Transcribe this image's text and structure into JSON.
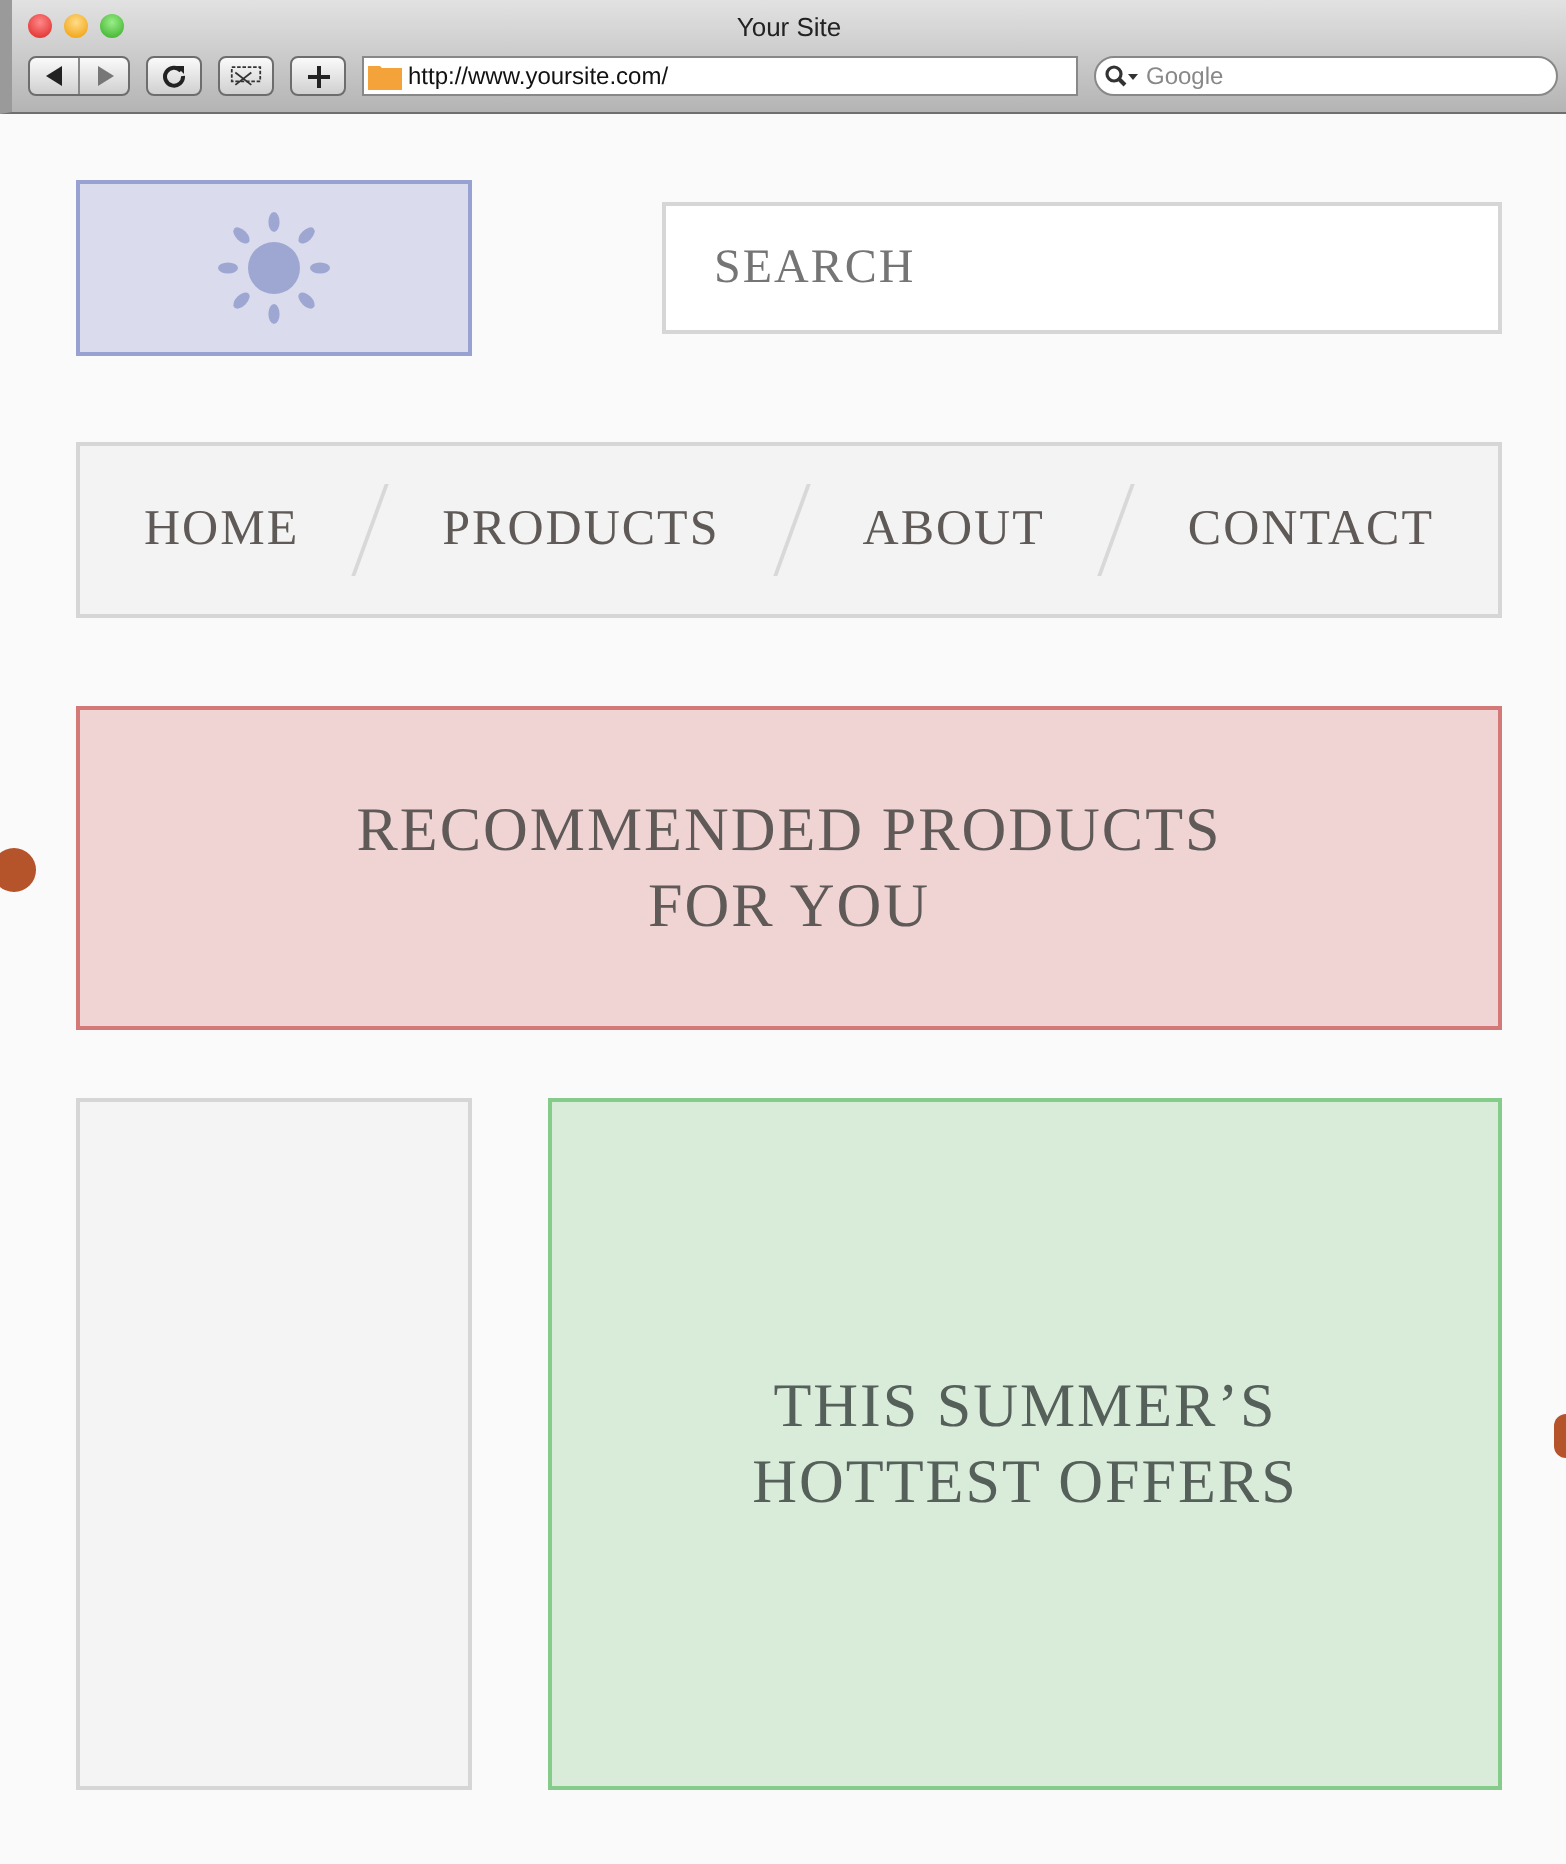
{
  "window": {
    "title": "Your Site"
  },
  "toolbar": {
    "url": "http://www.yoursite.com/",
    "search_placeholder": "Google"
  },
  "page": {
    "search": {
      "placeholder": "SEARCH"
    },
    "nav": [
      {
        "label": "HOME"
      },
      {
        "label": "PRODUCTS"
      },
      {
        "label": "ABOUT"
      },
      {
        "label": "CONTACT"
      }
    ],
    "banner": {
      "text": "RECOMMENDED PRODUCTS FOR YOU"
    },
    "offers": {
      "text": "THIS SUMMER’S HOTTEST OFFERS"
    }
  }
}
